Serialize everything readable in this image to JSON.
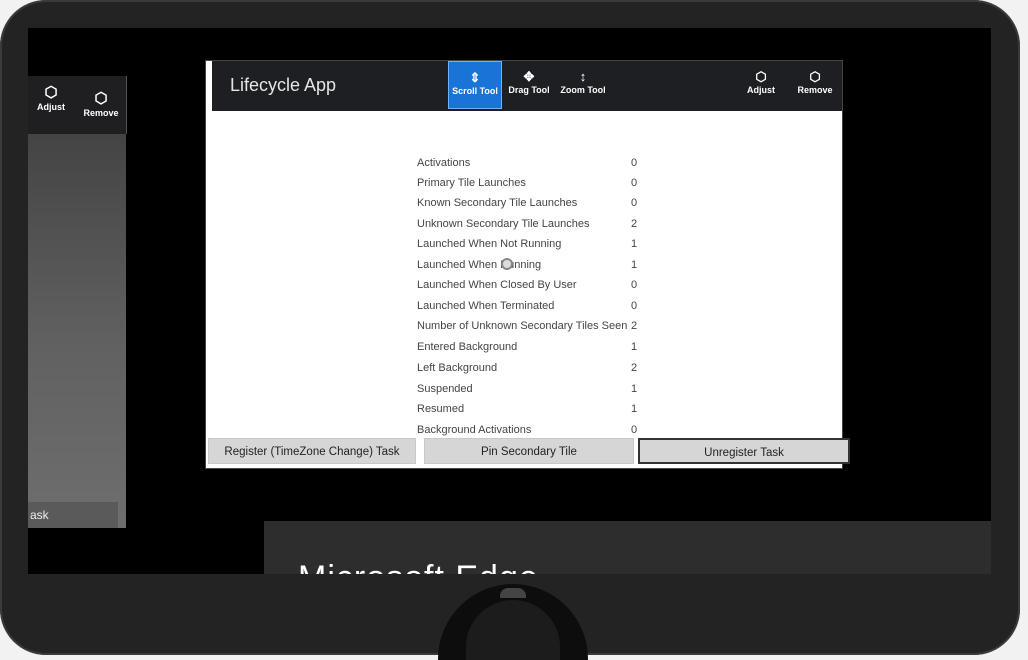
{
  "left_window": {
    "tools": [
      {
        "label": "Adjust",
        "icon": "adjust-icon"
      },
      {
        "label": "Remove",
        "icon": "remove-icon"
      }
    ],
    "footer_text": "ask"
  },
  "app": {
    "title": "Lifecycle App",
    "tools": [
      {
        "label": "Scroll Tool",
        "icon": "scroll-tool-icon",
        "active": true
      },
      {
        "label": "Drag Tool",
        "icon": "drag-tool-icon",
        "active": false
      },
      {
        "label": "Zoom Tool",
        "icon": "zoom-tool-icon",
        "active": false
      },
      {
        "label": "Adjust",
        "icon": "adjust-icon",
        "active": false
      },
      {
        "label": "Remove",
        "icon": "remove-icon",
        "active": false
      }
    ],
    "stats": [
      {
        "label": "Activations",
        "value": "0"
      },
      {
        "label": "Primary Tile Launches",
        "value": "0"
      },
      {
        "label": "Known Secondary Tile Launches",
        "value": "0"
      },
      {
        "label": "Unknown Secondary Tile Launches",
        "value": "2"
      },
      {
        "label": "Launched When Not Running",
        "value": "1"
      },
      {
        "label": "Launched When Running",
        "value": "1"
      },
      {
        "label": "Launched When Closed By User",
        "value": "0"
      },
      {
        "label": "Launched When Terminated",
        "value": "0"
      },
      {
        "label": "Number of Unknown Secondary Tiles Seen",
        "value": "2"
      },
      {
        "label": "Entered Background",
        "value": "1"
      },
      {
        "label": "Left Background",
        "value": "2"
      },
      {
        "label": "Suspended",
        "value": "1"
      },
      {
        "label": "Resumed",
        "value": "1"
      },
      {
        "label": "Background Activations",
        "value": "0"
      }
    ],
    "buttons": {
      "register": "Register (TimeZone Change) Task",
      "pin": "Pin Secondary Tile",
      "unregister": "Unregister Task"
    },
    "colors": {
      "active_tool": "#1a74d8",
      "titlebar": "#1e1f22"
    }
  },
  "edge_window": {
    "title": "Microsoft Edge"
  }
}
